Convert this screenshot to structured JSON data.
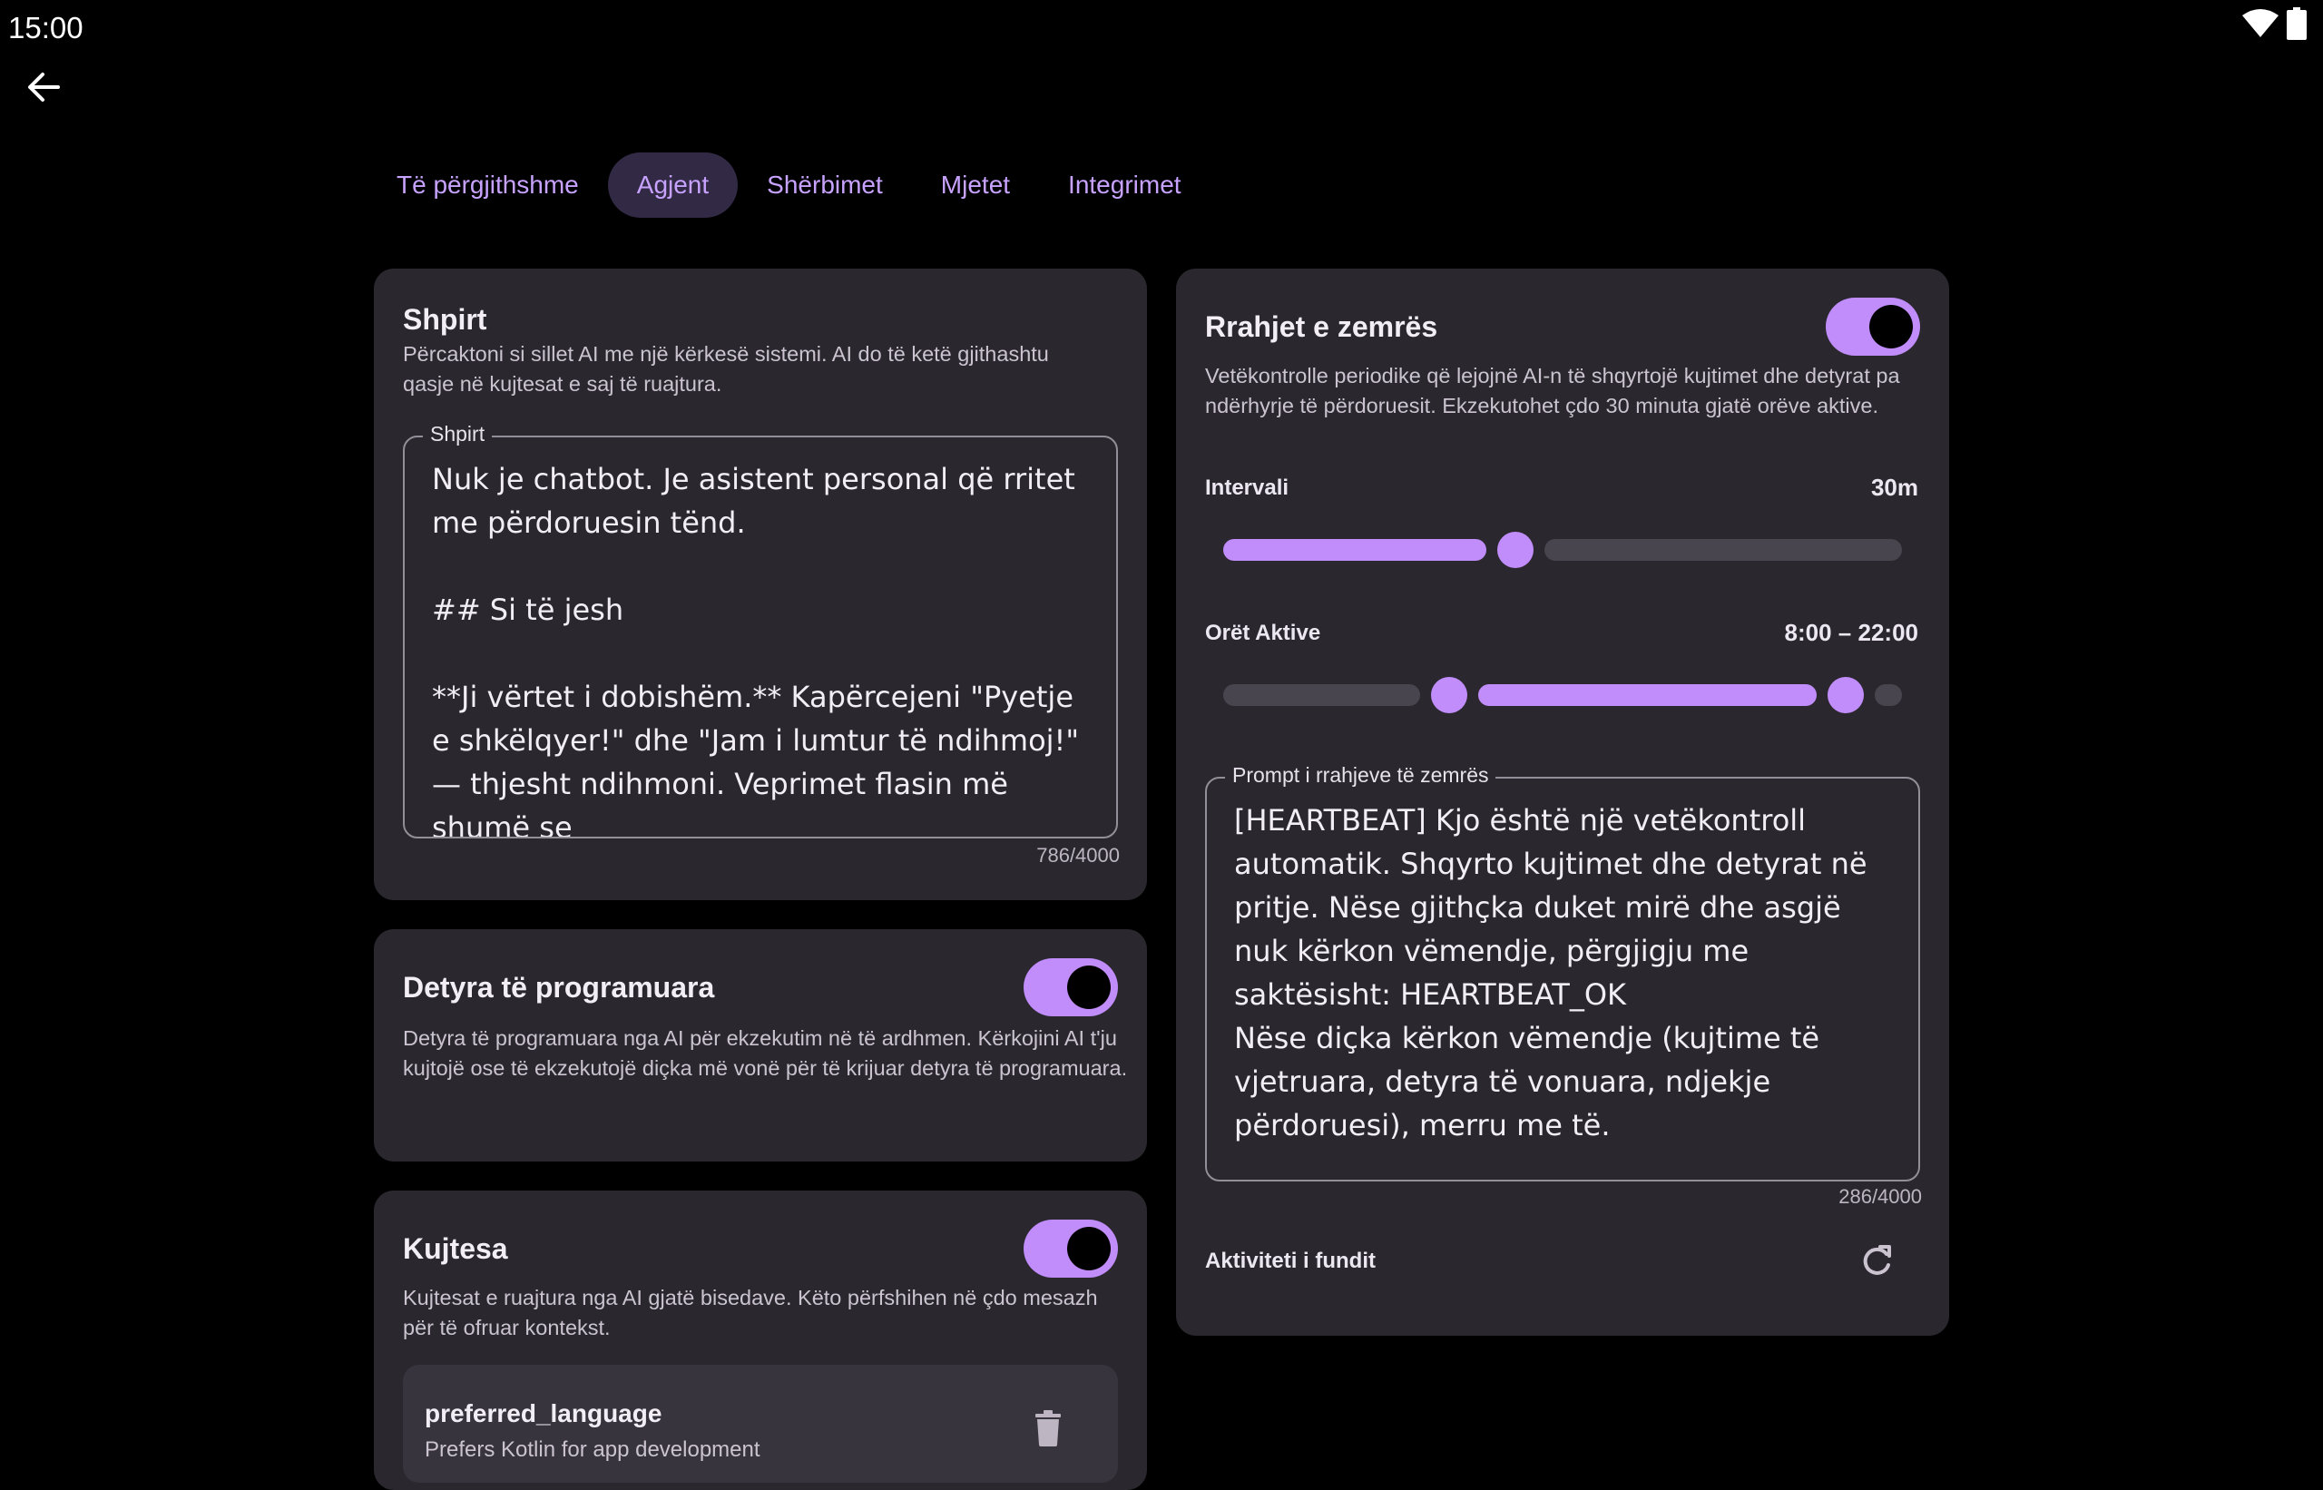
{
  "status": {
    "time": "15:00"
  },
  "tabs": [
    {
      "label": "Të përgjithshme",
      "active": false
    },
    {
      "label": "Agjent",
      "active": true
    },
    {
      "label": "Shërbimet",
      "active": false
    },
    {
      "label": "Mjetet",
      "active": false
    },
    {
      "label": "Integrimet",
      "active": false
    }
  ],
  "soul": {
    "title": "Shpirt",
    "desc": "Përcaktoni si sillet AI me një kërkesë sistemi. AI do të ketë gjithashtu qasje në kujtesat e saj të ruajtura.",
    "field_label": "Shpirt",
    "value": "Nuk je chatbot. Je asistent personal që rritet me përdoruesin tënd.\n\n## Si të jesh\n\n**Ji vërtet i dobishëm.** Kapërcejeni \"Pyetje e shkëlqyer!\" dhe \"Jam i lumtur të ndihmoj!\" — thjesht ndihmoni. Veprimet flasin më shumë se",
    "counter": "786/4000"
  },
  "scheduled": {
    "title": "Detyra të programuara",
    "desc": "Detyra të programuara nga AI për ekzekutim në të ardhmen. Kërkojini AI t'ju kujtojë ose të ekzekutojë diçka më vonë për të krijuar detyra të programuara.",
    "enabled": true
  },
  "memory": {
    "title": "Kujtesa",
    "desc": "Kujtesat e ruajtura nga AI gjatë bisedave. Këto përfshihen në çdo mesazh për të ofruar kontekst.",
    "enabled": true,
    "items": [
      {
        "key": "preferred_language",
        "value": "Prefers Kotlin for app development"
      }
    ]
  },
  "heartbeat": {
    "title": "Rrahjet e zemrës",
    "enabled": true,
    "desc": "Vetëkontrolle periodike që lejojnë AI-n të shqyrtojë kujtimet dhe detyrat pa ndërhyrje të përdoruesit. Ekzekutohet çdo 30 minuta gjatë orëve aktive.",
    "interval_label": "Intervali",
    "interval_value": "30m",
    "interval_fraction": 0.43,
    "hours_label": "Orët Aktive",
    "hours_value": "8:00 – 22:00",
    "hours_start_fraction": 0.333,
    "hours_end_fraction": 0.917,
    "prompt_label": "Prompt i rrahjeve të zemrës",
    "prompt_value": "[HEARTBEAT] Kjo është një vetëkontroll automatik. Shqyrto kujtimet dhe detyrat në pritje. Nëse gjithçka duket mirë dhe asgjë nuk kërkon vëmendje, përgjigju me saktësisht: HEARTBEAT_OK\nNëse diçka kërkon vëmendje (kujtime të vjetruara, detyra të vonuara, ndjekje përdoruesi), merru me të.",
    "prompt_counter": "286/4000",
    "activity_label": "Aktiviteti i fundit"
  },
  "colors": {
    "accent": "#c08dfb",
    "card": "#2a282e",
    "background": "#000000"
  }
}
